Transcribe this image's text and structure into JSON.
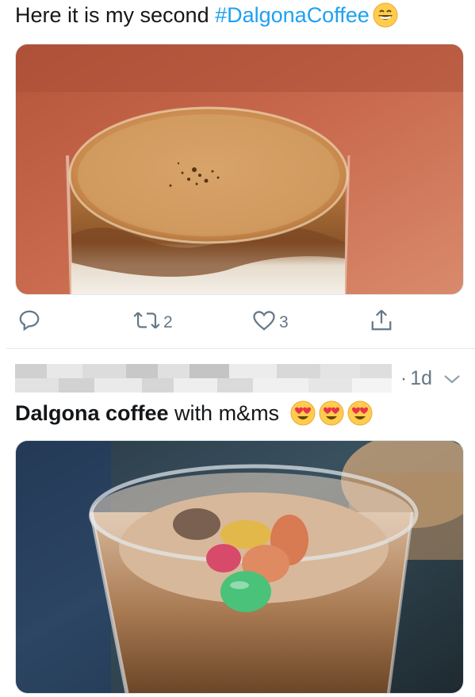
{
  "tweet1": {
    "text_prefix": "Here it is my second ",
    "hashtag": "#DalgonaCoffee",
    "emoji": "grinning-face-emoji",
    "actions": {
      "reply_icon": "reply-icon",
      "retweet_icon": "retweet-icon",
      "retweet_count": "2",
      "like_icon": "heart-icon",
      "like_count": "3",
      "share_icon": "share-icon"
    }
  },
  "tweet2": {
    "timestamp": "1d",
    "separator": "·",
    "menu_icon": "chevron-down-icon",
    "text_bold": "Dalgona coffee",
    "text_rest": " with m&ms",
    "emojis": [
      "heart-eyes-emoji",
      "heart-eyes-emoji",
      "heart-eyes-emoji"
    ]
  },
  "colors": {
    "link": "#1da1f2",
    "secondary": "#657786",
    "divider": "#e1e8ed"
  }
}
